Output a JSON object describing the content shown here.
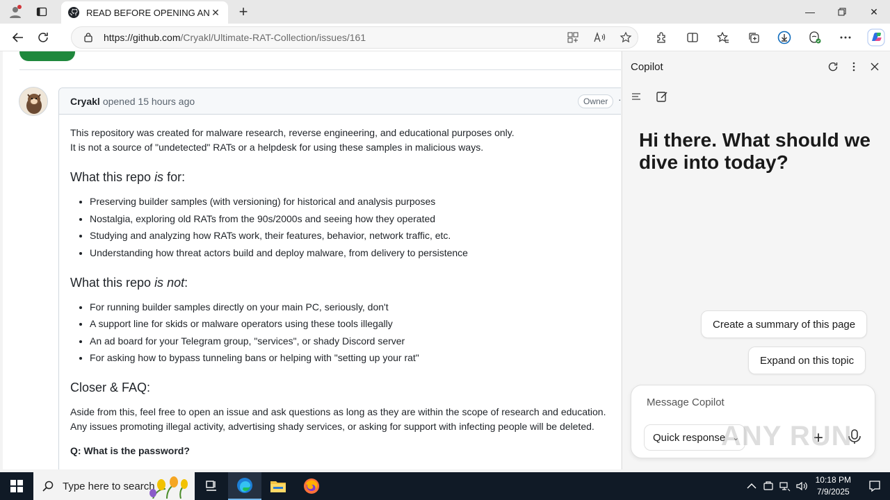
{
  "browser": {
    "tab_title": "READ BEFORE OPENING AN ISSU",
    "url_host": "https://github.com",
    "url_path": "/Cryakl/Ultimate-RAT-Collection/issues/161"
  },
  "issue": {
    "author": "Cryakl",
    "opened_text": "opened 15 hours ago",
    "role_badge": "Owner",
    "intro_line1": "This repository was created for malware research, reverse engineering, and educational purposes only.",
    "intro_line2": "It is not a source of \"undetected\" RATs or a helpdesk for using these samples in malicious ways.",
    "h_is_for": {
      "pre": "What this repo ",
      "em": "is",
      "post": " for:"
    },
    "is_for_items": [
      "Preserving builder samples (with versioning) for historical and analysis purposes",
      "Nostalgia, exploring old RATs from the 90s/2000s and seeing how they operated",
      "Studying and analyzing how RATs work, their features, behavior, network traffic, etc.",
      "Understanding how threat actors build and deploy malware, from delivery to persistence"
    ],
    "h_is_not": {
      "pre": "What this repo ",
      "em": "is not",
      "post": ":"
    },
    "is_not_items": [
      "For running builder samples directly on your main PC, seriously, don't",
      "A support line for skids or malware operators using these tools illegally",
      "An ad board for your Telegram group, \"services\", or shady Discord server",
      "For asking how to bypass tunneling bans or helping with \"setting up your rat\""
    ],
    "h_faq": "Closer & FAQ:",
    "faq_line1": "Aside from this, feel free to open an issue and ask questions as long as they are within the scope of research and education.",
    "faq_line2": "Any issues promoting illegal activity, advertising shady services, or asking for support with infecting people will be deleted.",
    "q_password": "Q: What is the password?"
  },
  "copilot": {
    "title": "Copilot",
    "greeting": "Hi there. What should we dive into today?",
    "chip_summary": "Create a summary of this page",
    "chip_expand": "Expand on this topic",
    "input_placeholder": "Message Copilot",
    "mode": "Quick response"
  },
  "watermark": "ANY RUN",
  "taskbar": {
    "search_placeholder": "Type here to search",
    "time": "10:18 PM",
    "date": "7/9/2025"
  },
  "colors": {
    "accent_green": "#1f883d",
    "taskbar_bg": "#101a26"
  }
}
